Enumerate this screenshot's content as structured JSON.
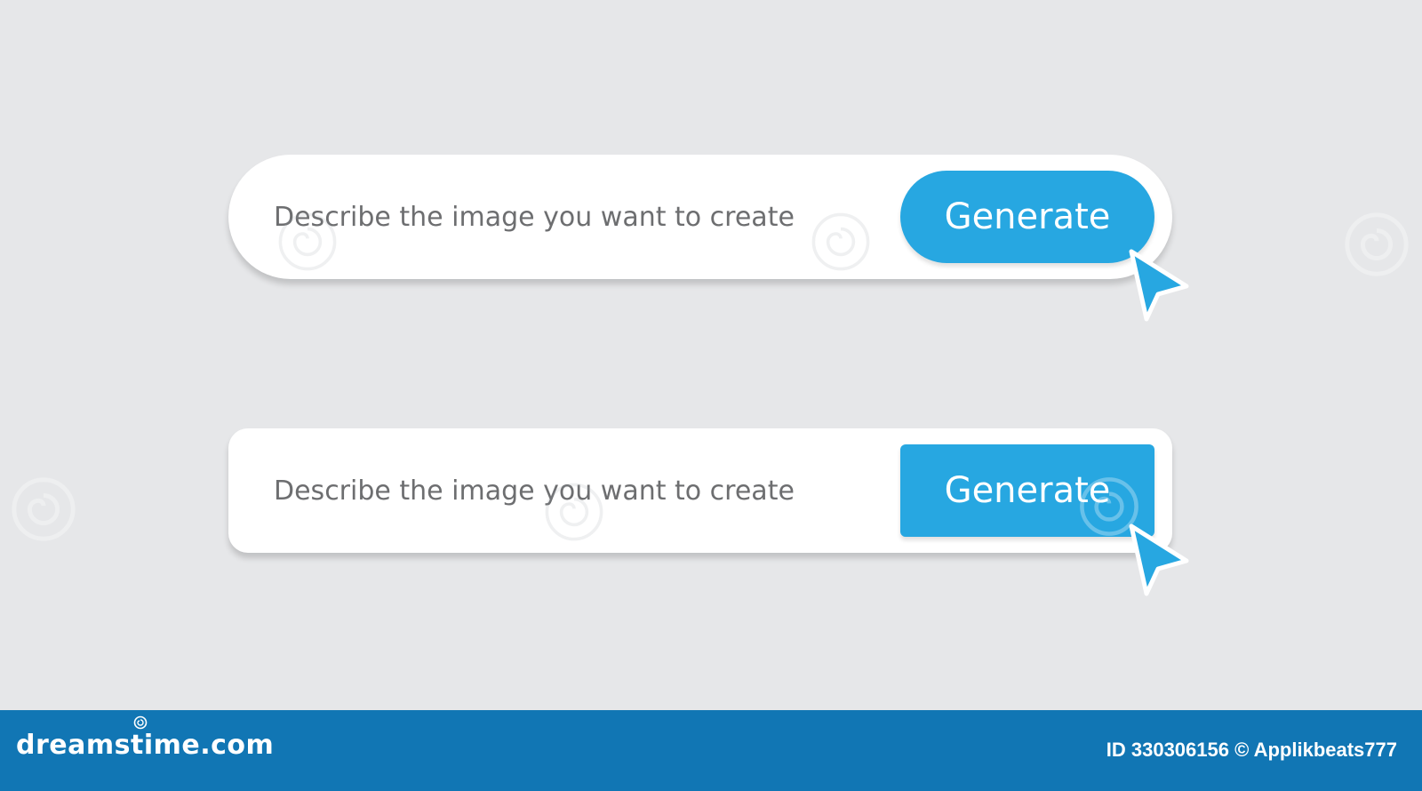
{
  "prompt_bars": [
    {
      "style": "pill",
      "placeholder": "Describe the image you want to create",
      "button_label": "Generate"
    },
    {
      "style": "rounded-rect",
      "placeholder": "Describe the image you want to create",
      "button_label": "Generate"
    }
  ],
  "footer": {
    "logo_text": "dreamstime.com",
    "credit": "ID 330306156 © Applikbeats777"
  },
  "colors": {
    "background": "#e6e7e9",
    "accent": "#27a7e1",
    "footer": "#1176b4",
    "placeholder_text": "#6d6e70"
  },
  "icons": [
    "cursor-arrow-icon",
    "dreamstime-spiral-icon"
  ]
}
